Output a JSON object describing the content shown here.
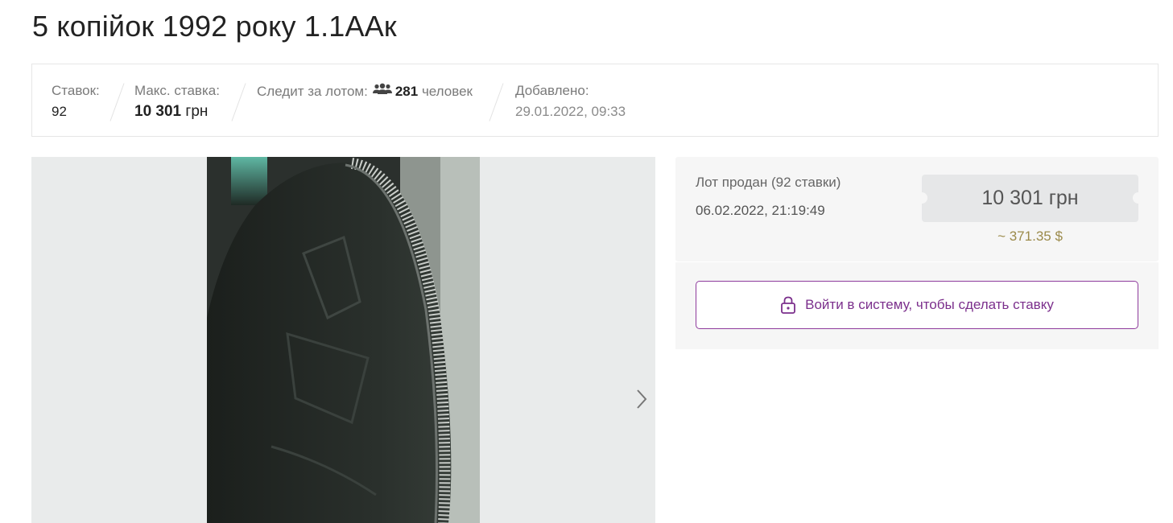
{
  "lot": {
    "title": "5 копійок 1992 року 1.1ААк"
  },
  "stats": {
    "bids_label": "Ставок:",
    "bids_value": "92",
    "max_bid_label": "Макс. ставка:",
    "max_bid_amount": "10 301",
    "max_bid_currency": "грн",
    "watchers_label": "Следит за лотом:",
    "watchers_count": "281",
    "watchers_unit": "человек",
    "watchers_icon": "people-icon",
    "added_label": "Добавлено:",
    "added_value": "29.01.2022, 09:33"
  },
  "gallery": {
    "next_icon": "chevron-right-icon"
  },
  "sale": {
    "status": "Лот продан (92 ставки)",
    "date": "06.02.2022, 21:19:49",
    "price": "10 301 грн",
    "price_usd": "~ 371.35 $"
  },
  "login": {
    "button_label": "Войти в систему, чтобы сделать ставку",
    "icon": "lock-icon",
    "accent_color": "#7b2f8c"
  }
}
